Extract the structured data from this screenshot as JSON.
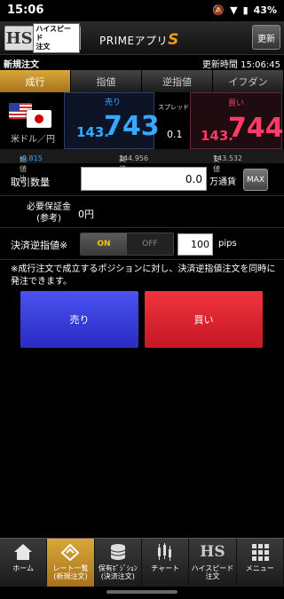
{
  "status_bar": {
    "time": "15:06",
    "battery": "43%"
  },
  "header": {
    "logo_text": "HS",
    "logo_badge": "ハイスピード\n注文",
    "app_name": "PRIMEアプリ",
    "app_name_s": "S",
    "refresh_label": "更新"
  },
  "page": {
    "title": "新規注文",
    "updated_label": "更新時間",
    "updated_time": "15:06:45"
  },
  "tabs": [
    {
      "label": "成行",
      "active": true
    },
    {
      "label": "指値"
    },
    {
      "label": "逆指値"
    },
    {
      "label": "イフダン"
    }
  ],
  "rate": {
    "pair": "米ドル／円",
    "sell_label": "売り",
    "sell_prefix": "143.",
    "sell_pips": "743",
    "spread_label": "スプレッド",
    "spread_value": "0.1",
    "buy_label": "買い",
    "buy_prefix": "143.",
    "buy_pips": "744"
  },
  "stats": {
    "open_label": "始値比",
    "open_value": "-0.815",
    "high_label": "高値",
    "high_value": "144.956",
    "low_label": "安値",
    "low_value": "143.532"
  },
  "form": {
    "qty_label": "取引数量",
    "qty_value": "0.0",
    "qty_unit": "万通貨",
    "max_label": "MAX",
    "margin_label_1": "必要保証金",
    "margin_label_2": "(参考)",
    "margin_value": "0円",
    "settle_label": "決済逆指値",
    "settle_star": "※",
    "on_label": "ON",
    "off_label": "OFF",
    "pips_value": "100",
    "pips_unit": "pips",
    "note": "※成行注文で成立するポジションに対し、決済逆指値注文を同時に発注できます。",
    "sell_button": "売り",
    "buy_button": "買い"
  },
  "nav": [
    {
      "label": "ホーム",
      "icon": "home-icon"
    },
    {
      "label": "レート一覧\n(新規注文)",
      "icon": "rate-list-icon",
      "active": true
    },
    {
      "label": "保有ﾎﾟｼﾞｼｮﾝ\n(決済注文)",
      "icon": "coins-icon"
    },
    {
      "label": "チャート",
      "icon": "chart-icon"
    },
    {
      "label": "ハイスピード\n注文",
      "icon": "hs-icon"
    },
    {
      "label": "メニュー",
      "icon": "grid-icon"
    }
  ],
  "colors": {
    "sell": "#38a8ff",
    "buy": "#ff3b6a",
    "accent": "#d9a83a"
  }
}
